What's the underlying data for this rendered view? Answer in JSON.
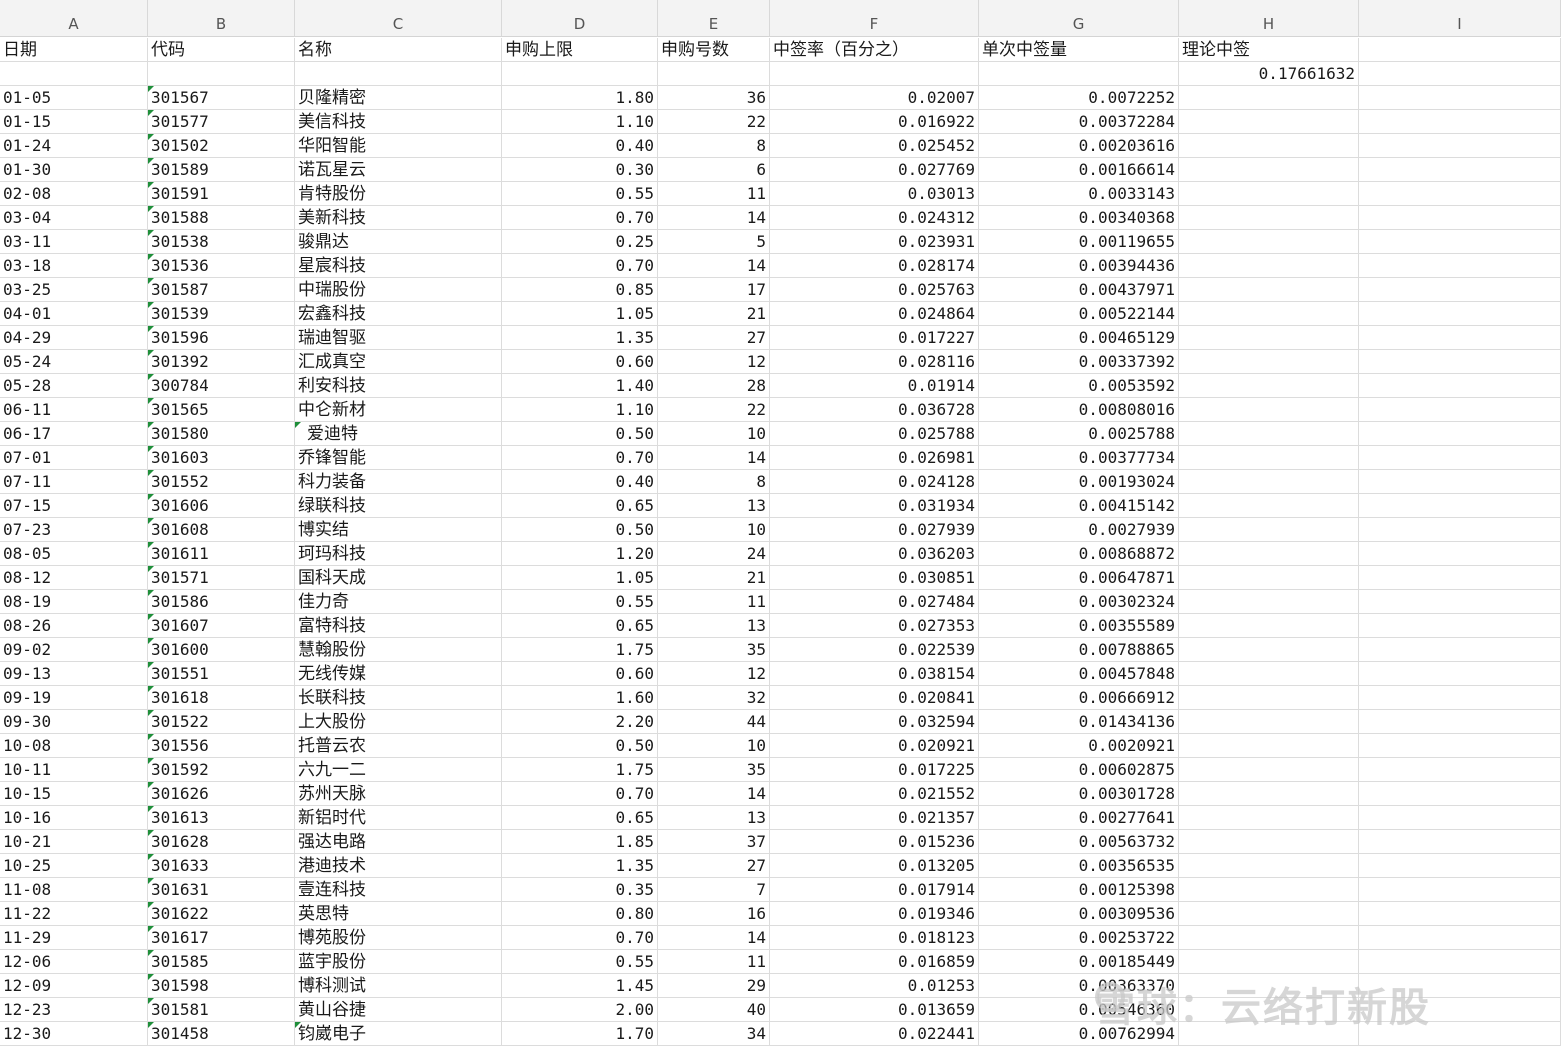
{
  "columns": [
    "A",
    "B",
    "C",
    "D",
    "E",
    "F",
    "G",
    "H",
    "I"
  ],
  "headers": {
    "date": "日期",
    "code": "代码",
    "name": "名称",
    "limit": "申购上限",
    "count": "申购号数",
    "rate": "中签率（百分之）",
    "single": "单次中签量",
    "theory": "理论中签"
  },
  "theory_total": "0.17661632",
  "rows": [
    [
      "01-05",
      "301567",
      "贝隆精密",
      "1.80",
      "36",
      "0.02007",
      "0.0072252"
    ],
    [
      "01-15",
      "301577",
      "美信科技",
      "1.10",
      "22",
      "0.016922",
      "0.00372284"
    ],
    [
      "01-24",
      "301502",
      "华阳智能",
      "0.40",
      "8",
      "0.025452",
      "0.00203616"
    ],
    [
      "01-30",
      "301589",
      "诺瓦星云",
      "0.30",
      "6",
      "0.027769",
      "0.00166614"
    ],
    [
      "02-08",
      "301591",
      "肯特股份",
      "0.55",
      "11",
      "0.03013",
      "0.0033143"
    ],
    [
      "03-04",
      "301588",
      "美新科技",
      "0.70",
      "14",
      "0.024312",
      "0.00340368"
    ],
    [
      "03-11",
      "301538",
      "骏鼎达",
      "0.25",
      "5",
      "0.023931",
      "0.00119655"
    ],
    [
      "03-18",
      "301536",
      "星宸科技",
      "0.70",
      "14",
      "0.028174",
      "0.00394436"
    ],
    [
      "03-25",
      "301587",
      "中瑞股份",
      "0.85",
      "17",
      "0.025763",
      "0.00437971"
    ],
    [
      "04-01",
      "301539",
      "宏鑫科技",
      "1.05",
      "21",
      "0.024864",
      "0.00522144"
    ],
    [
      "04-29",
      "301596",
      "瑞迪智驱",
      "1.35",
      "27",
      "0.017227",
      "0.00465129"
    ],
    [
      "05-24",
      "301392",
      "汇成真空",
      "0.60",
      "12",
      "0.028116",
      "0.00337392"
    ],
    [
      "05-28",
      "300784",
      "利安科技",
      "1.40",
      "28",
      "0.01914",
      "0.0053592"
    ],
    [
      "06-11",
      "301565",
      "中仑新材",
      "1.10",
      "22",
      "0.036728",
      "0.00808016"
    ],
    [
      "06-17",
      "301580",
      "爱迪特",
      "0.50",
      "10",
      "0.025788",
      "0.0025788"
    ],
    [
      "07-01",
      "301603",
      "乔锋智能",
      "0.70",
      "14",
      "0.026981",
      "0.00377734"
    ],
    [
      "07-11",
      "301552",
      "科力装备",
      "0.40",
      "8",
      "0.024128",
      "0.00193024"
    ],
    [
      "07-15",
      "301606",
      "绿联科技",
      "0.65",
      "13",
      "0.031934",
      "0.00415142"
    ],
    [
      "07-23",
      "301608",
      "博实结",
      "0.50",
      "10",
      "0.027939",
      "0.0027939"
    ],
    [
      "08-05",
      "301611",
      "珂玛科技",
      "1.20",
      "24",
      "0.036203",
      "0.00868872"
    ],
    [
      "08-12",
      "301571",
      "国科天成",
      "1.05",
      "21",
      "0.030851",
      "0.00647871"
    ],
    [
      "08-19",
      "301586",
      "佳力奇",
      "0.55",
      "11",
      "0.027484",
      "0.00302324"
    ],
    [
      "08-26",
      "301607",
      "富特科技",
      "0.65",
      "13",
      "0.027353",
      "0.00355589"
    ],
    [
      "09-02",
      "301600",
      "慧翰股份",
      "1.75",
      "35",
      "0.022539",
      "0.00788865"
    ],
    [
      "09-13",
      "301551",
      "无线传媒",
      "0.60",
      "12",
      "0.038154",
      "0.00457848"
    ],
    [
      "09-19",
      "301618",
      "长联科技",
      "1.60",
      "32",
      "0.020841",
      "0.00666912"
    ],
    [
      "09-30",
      "301522",
      "上大股份",
      "2.20",
      "44",
      "0.032594",
      "0.01434136"
    ],
    [
      "10-08",
      "301556",
      "托普云农",
      "0.50",
      "10",
      "0.020921",
      "0.0020921"
    ],
    [
      "10-11",
      "301592",
      "六九一二",
      "1.75",
      "35",
      "0.017225",
      "0.00602875"
    ],
    [
      "10-15",
      "301626",
      "苏州天脉",
      "0.70",
      "14",
      "0.021552",
      "0.00301728"
    ],
    [
      "10-16",
      "301613",
      "新铝时代",
      "0.65",
      "13",
      "0.021357",
      "0.00277641"
    ],
    [
      "10-21",
      "301628",
      "强达电路",
      "1.85",
      "37",
      "0.015236",
      "0.00563732"
    ],
    [
      "10-25",
      "301633",
      "港迪技术",
      "1.35",
      "27",
      "0.013205",
      "0.00356535"
    ],
    [
      "11-08",
      "301631",
      "壹连科技",
      "0.35",
      "7",
      "0.017914",
      "0.00125398"
    ],
    [
      "11-22",
      "301622",
      "英思特",
      "0.80",
      "16",
      "0.019346",
      "0.00309536"
    ],
    [
      "11-29",
      "301617",
      "博苑股份",
      "0.70",
      "14",
      "0.018123",
      "0.00253722"
    ],
    [
      "12-06",
      "301585",
      "蓝宇股份",
      "0.55",
      "11",
      "0.016859",
      "0.00185449"
    ],
    [
      "12-09",
      "301598",
      "博科测试",
      "1.45",
      "29",
      "0.01253",
      "0.00363370"
    ],
    [
      "12-23",
      "301581",
      "黄山谷捷",
      "2.00",
      "40",
      "0.013659",
      "0.00546360"
    ],
    [
      "12-30",
      "301458",
      "钧崴电子",
      "1.70",
      "34",
      "0.022441",
      "0.00762994"
    ]
  ],
  "watermark": "雪球：云络打新股"
}
